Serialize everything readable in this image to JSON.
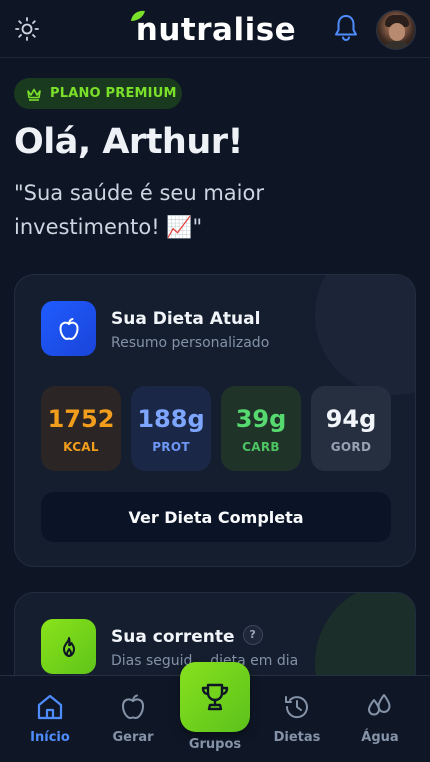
{
  "app": {
    "name": "nutralise"
  },
  "header": {
    "theme_icon": "sun-icon",
    "notification_icon": "bell-icon",
    "avatar": "user-avatar"
  },
  "badge": {
    "label": "PLANO PREMIUM",
    "icon": "crown-icon",
    "color": "#7be02a"
  },
  "greeting": {
    "title": "Olá, Arthur!",
    "quote": "\"Sua saúde é seu maior investimento! 📈\""
  },
  "diet_card": {
    "icon": "apple-icon",
    "title": "Sua Dieta Atual",
    "subtitle": "Resumo personalizado",
    "macros": [
      {
        "value": "1752",
        "label": "KCAL",
        "color": "#f29d1c"
      },
      {
        "value": "188g",
        "label": "PROT",
        "color": "#7ea6ff"
      },
      {
        "value": "39g",
        "label": "CARB",
        "color": "#56d96f"
      },
      {
        "value": "94g",
        "label": "GORD",
        "color": "#f1f5f9"
      }
    ],
    "button_label": "Ver Dieta Completa"
  },
  "streak_card": {
    "icon": "flame-icon",
    "title": "Sua corrente",
    "help": "?",
    "subtitle": "Dias seguid... dieta em dia"
  },
  "nav": {
    "items": [
      {
        "label": "Início",
        "icon": "home-icon",
        "active": true
      },
      {
        "label": "Gerar",
        "icon": "apple-icon"
      },
      {
        "label": "Grupos",
        "icon": "trophy-icon"
      },
      {
        "label": "Dietas",
        "icon": "history-icon"
      },
      {
        "label": "Água",
        "icon": "water-drops-icon"
      }
    ]
  },
  "colors": {
    "accent_green": "#7be02a",
    "accent_blue": "#4f8dff",
    "background": "#0e1525"
  }
}
